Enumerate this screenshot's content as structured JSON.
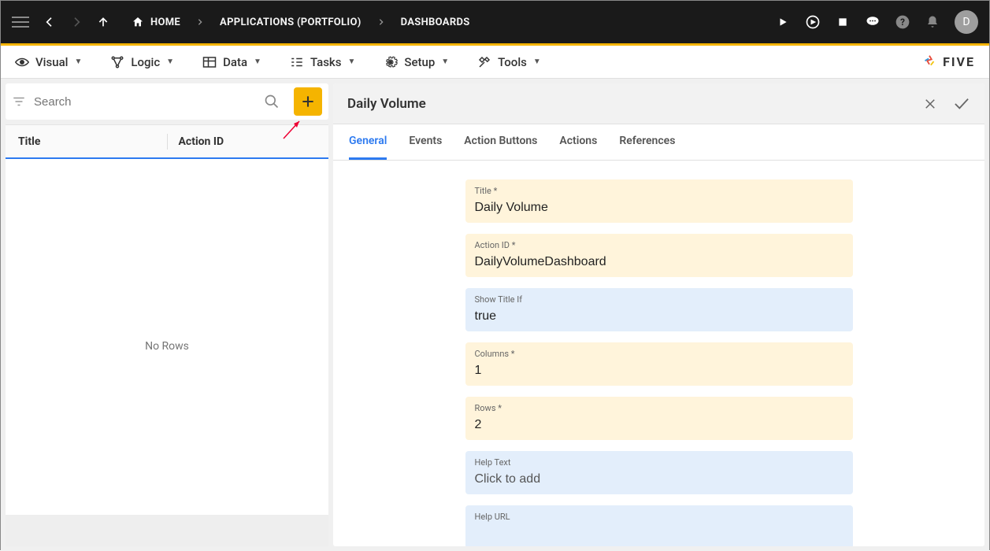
{
  "topbar": {
    "breadcrumb": [
      {
        "label": "HOME"
      },
      {
        "label": "APPLICATIONS (PORTFOLIO)"
      },
      {
        "label": "DASHBOARDS"
      }
    ],
    "avatar_letter": "D"
  },
  "menubar": {
    "items": [
      {
        "label": "Visual"
      },
      {
        "label": "Logic"
      },
      {
        "label": "Data"
      },
      {
        "label": "Tasks"
      },
      {
        "label": "Setup"
      },
      {
        "label": "Tools"
      }
    ],
    "brand": "FIVE"
  },
  "left": {
    "search_placeholder": "Search",
    "columns": {
      "c1": "Title",
      "c2": "Action ID"
    },
    "empty": "No Rows"
  },
  "detail": {
    "title": "Daily Volume",
    "tabs": [
      {
        "label": "General"
      },
      {
        "label": "Events"
      },
      {
        "label": "Action Buttons"
      },
      {
        "label": "Actions"
      },
      {
        "label": "References"
      }
    ],
    "fields": {
      "title": {
        "label": "Title *",
        "value": "Daily Volume"
      },
      "action_id": {
        "label": "Action ID *",
        "value": "DailyVolumeDashboard"
      },
      "show_title_if": {
        "label": "Show Title If",
        "value": "true"
      },
      "columns": {
        "label": "Columns *",
        "value": "1"
      },
      "rows": {
        "label": "Rows *",
        "value": "2"
      },
      "help_text": {
        "label": "Help Text",
        "value": "Click to add"
      },
      "help_url": {
        "label": "Help URL",
        "value": ""
      }
    }
  }
}
